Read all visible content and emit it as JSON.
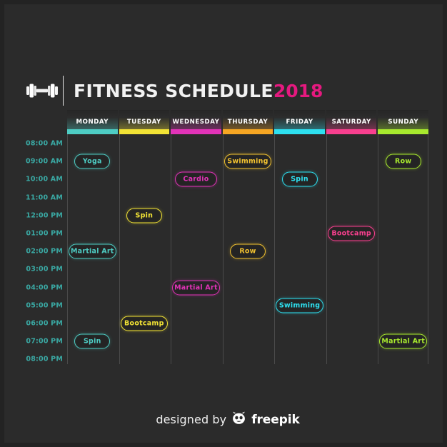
{
  "header": {
    "logo_icon": "dumbbell-icon",
    "title": "FITNESS SCHEDULE",
    "year": "2018",
    "year_color": "#e5197f"
  },
  "colors": {
    "background": "#2b2b2b",
    "grid_line": "#4a4a4a",
    "time_label": "#3aa9a4"
  },
  "days": [
    {
      "label": "MONDAY",
      "accent": "#4ecdc4"
    },
    {
      "label": "TUESDAY",
      "accent": "#f2e335"
    },
    {
      "label": "WEDNESDAY",
      "accent": "#e233b8"
    },
    {
      "label": "THURSDAY",
      "accent": "#f6a623"
    },
    {
      "label": "FRIDAY",
      "accent": "#2ee0f0"
    },
    {
      "label": "SATURDAY",
      "accent": "#f9408f"
    },
    {
      "label": "SUNDAY",
      "accent": "#a8e92e"
    }
  ],
  "times": [
    "08:00 AM",
    "09:00 AM",
    "10:00 AM",
    "11:00 AM",
    "12:00 PM",
    "01:00 PM",
    "02:00 PM",
    "03:00 PM",
    "04:00 PM",
    "05:00 PM",
    "06:00 PM",
    "07:00 PM",
    "08:00 PM"
  ],
  "events": [
    {
      "day": "MONDAY",
      "day_index": 0,
      "time": "09:00 AM",
      "time_index": 1,
      "label": "Yoga",
      "color": "#4ecdc4"
    },
    {
      "day": "MONDAY",
      "day_index": 0,
      "time": "02:00 PM",
      "time_index": 6,
      "label": "Martial Art",
      "color": "#4ecdc4"
    },
    {
      "day": "MONDAY",
      "day_index": 0,
      "time": "07:00 PM",
      "time_index": 11,
      "label": "Spin",
      "color": "#4ecdc4"
    },
    {
      "day": "TUESDAY",
      "day_index": 1,
      "time": "12:00 PM",
      "time_index": 4,
      "label": "Spin",
      "color": "#f2e335"
    },
    {
      "day": "TUESDAY",
      "day_index": 1,
      "time": "06:00 PM",
      "time_index": 10,
      "label": "Bootcamp",
      "color": "#f2e335"
    },
    {
      "day": "WEDNESDAY",
      "day_index": 2,
      "time": "10:00 AM",
      "time_index": 2,
      "label": "Cardio",
      "color": "#e233b8"
    },
    {
      "day": "WEDNESDAY",
      "day_index": 2,
      "time": "04:00 PM",
      "time_index": 8,
      "label": "Martial Art",
      "color": "#e233b8"
    },
    {
      "day": "THURSDAY",
      "day_index": 3,
      "time": "09:00 AM",
      "time_index": 1,
      "label": "Swimming",
      "color": "#f2c230"
    },
    {
      "day": "THURSDAY",
      "day_index": 3,
      "time": "02:00 PM",
      "time_index": 6,
      "label": "Row",
      "color": "#f2c230"
    },
    {
      "day": "FRIDAY",
      "day_index": 4,
      "time": "10:00 AM",
      "time_index": 2,
      "label": "Spin",
      "color": "#2ee0f0"
    },
    {
      "day": "FRIDAY",
      "day_index": 4,
      "time": "05:00 PM",
      "time_index": 9,
      "label": "Swimming",
      "color": "#2ee0f0"
    },
    {
      "day": "SATURDAY",
      "day_index": 5,
      "time": "01:00 PM",
      "time_index": 5,
      "label": "Bootcamp",
      "color": "#f9408f"
    },
    {
      "day": "SUNDAY",
      "day_index": 6,
      "time": "09:00 AM",
      "time_index": 1,
      "label": "Row",
      "color": "#a8e92e"
    },
    {
      "day": "SUNDAY",
      "day_index": 6,
      "time": "07:00 PM",
      "time_index": 11,
      "label": "Martial Art",
      "color": "#a8e92e"
    }
  ],
  "footer": {
    "designed_by": "designed by",
    "brand": "freepik",
    "brand_icon": "freepik-face-icon"
  }
}
